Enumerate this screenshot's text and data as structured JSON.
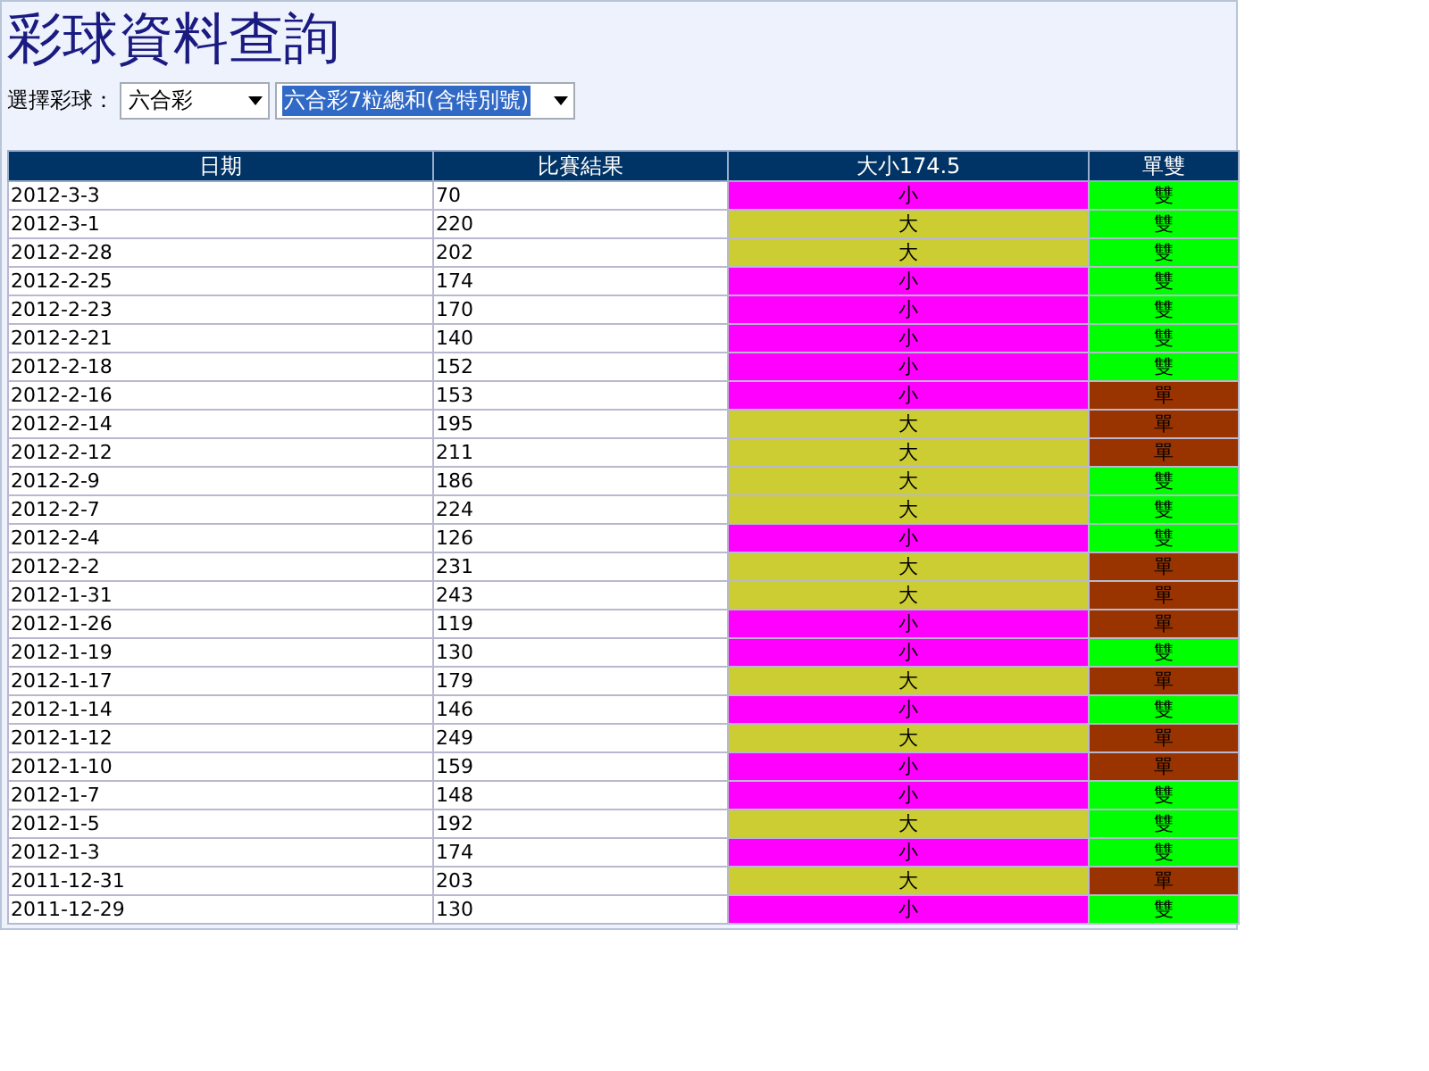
{
  "title": "彩球資料查詢",
  "filter": {
    "label": "選擇彩球：",
    "selects": [
      {
        "value": "六合彩",
        "focused": false
      },
      {
        "value": "六合彩7粒總和(含特別號)",
        "focused": true
      }
    ]
  },
  "table": {
    "columns": [
      "日期",
      "比賽結果",
      "大小174.5",
      "單雙"
    ],
    "rows": [
      {
        "date": "2012-3-3",
        "result": "70",
        "size": {
          "text": "小",
          "color": "#ff00ff"
        },
        "parity": {
          "text": "雙",
          "color": "#00ff00"
        }
      },
      {
        "date": "2012-3-1",
        "result": "220",
        "size": {
          "text": "大",
          "color": "#cccc33"
        },
        "parity": {
          "text": "雙",
          "color": "#00ff00"
        }
      },
      {
        "date": "2012-2-28",
        "result": "202",
        "size": {
          "text": "大",
          "color": "#cccc33"
        },
        "parity": {
          "text": "雙",
          "color": "#00ff00"
        }
      },
      {
        "date": "2012-2-25",
        "result": "174",
        "size": {
          "text": "小",
          "color": "#ff00ff"
        },
        "parity": {
          "text": "雙",
          "color": "#00ff00"
        }
      },
      {
        "date": "2012-2-23",
        "result": "170",
        "size": {
          "text": "小",
          "color": "#ff00ff"
        },
        "parity": {
          "text": "雙",
          "color": "#00ff00"
        }
      },
      {
        "date": "2012-2-21",
        "result": "140",
        "size": {
          "text": "小",
          "color": "#ff00ff"
        },
        "parity": {
          "text": "雙",
          "color": "#00ff00"
        }
      },
      {
        "date": "2012-2-18",
        "result": "152",
        "size": {
          "text": "小",
          "color": "#ff00ff"
        },
        "parity": {
          "text": "雙",
          "color": "#00ff00"
        }
      },
      {
        "date": "2012-2-16",
        "result": "153",
        "size": {
          "text": "小",
          "color": "#ff00ff"
        },
        "parity": {
          "text": "單",
          "color": "#993300"
        }
      },
      {
        "date": "2012-2-14",
        "result": "195",
        "size": {
          "text": "大",
          "color": "#cccc33"
        },
        "parity": {
          "text": "單",
          "color": "#993300"
        }
      },
      {
        "date": "2012-2-12",
        "result": "211",
        "size": {
          "text": "大",
          "color": "#cccc33"
        },
        "parity": {
          "text": "單",
          "color": "#993300"
        }
      },
      {
        "date": "2012-2-9",
        "result": "186",
        "size": {
          "text": "大",
          "color": "#cccc33"
        },
        "parity": {
          "text": "雙",
          "color": "#00ff00"
        }
      },
      {
        "date": "2012-2-7",
        "result": "224",
        "size": {
          "text": "大",
          "color": "#cccc33"
        },
        "parity": {
          "text": "雙",
          "color": "#00ff00"
        }
      },
      {
        "date": "2012-2-4",
        "result": "126",
        "size": {
          "text": "小",
          "color": "#ff00ff"
        },
        "parity": {
          "text": "雙",
          "color": "#00ff00"
        }
      },
      {
        "date": "2012-2-2",
        "result": "231",
        "size": {
          "text": "大",
          "color": "#cccc33"
        },
        "parity": {
          "text": "單",
          "color": "#993300"
        }
      },
      {
        "date": "2012-1-31",
        "result": "243",
        "size": {
          "text": "大",
          "color": "#cccc33"
        },
        "parity": {
          "text": "單",
          "color": "#993300"
        }
      },
      {
        "date": "2012-1-26",
        "result": "119",
        "size": {
          "text": "小",
          "color": "#ff00ff"
        },
        "parity": {
          "text": "單",
          "color": "#993300"
        }
      },
      {
        "date": "2012-1-19",
        "result": "130",
        "size": {
          "text": "小",
          "color": "#ff00ff"
        },
        "parity": {
          "text": "雙",
          "color": "#00ff00"
        }
      },
      {
        "date": "2012-1-17",
        "result": "179",
        "size": {
          "text": "大",
          "color": "#cccc33"
        },
        "parity": {
          "text": "單",
          "color": "#993300"
        }
      },
      {
        "date": "2012-1-14",
        "result": "146",
        "size": {
          "text": "小",
          "color": "#ff00ff"
        },
        "parity": {
          "text": "雙",
          "color": "#00ff00"
        }
      },
      {
        "date": "2012-1-12",
        "result": "249",
        "size": {
          "text": "大",
          "color": "#cccc33"
        },
        "parity": {
          "text": "單",
          "color": "#993300"
        }
      },
      {
        "date": "2012-1-10",
        "result": "159",
        "size": {
          "text": "小",
          "color": "#ff00ff"
        },
        "parity": {
          "text": "單",
          "color": "#993300"
        }
      },
      {
        "date": "2012-1-7",
        "result": "148",
        "size": {
          "text": "小",
          "color": "#ff00ff"
        },
        "parity": {
          "text": "雙",
          "color": "#00ff00"
        }
      },
      {
        "date": "2012-1-5",
        "result": "192",
        "size": {
          "text": "大",
          "color": "#cccc33"
        },
        "parity": {
          "text": "雙",
          "color": "#00ff00"
        }
      },
      {
        "date": "2012-1-3",
        "result": "174",
        "size": {
          "text": "小",
          "color": "#ff00ff"
        },
        "parity": {
          "text": "雙",
          "color": "#00ff00"
        }
      },
      {
        "date": "2011-12-31",
        "result": "203",
        "size": {
          "text": "大",
          "color": "#cccc33"
        },
        "parity": {
          "text": "單",
          "color": "#993300"
        }
      },
      {
        "date": "2011-12-29",
        "result": "130",
        "size": {
          "text": "小",
          "color": "#ff00ff"
        },
        "parity": {
          "text": "雙",
          "color": "#00ff00"
        }
      }
    ]
  }
}
